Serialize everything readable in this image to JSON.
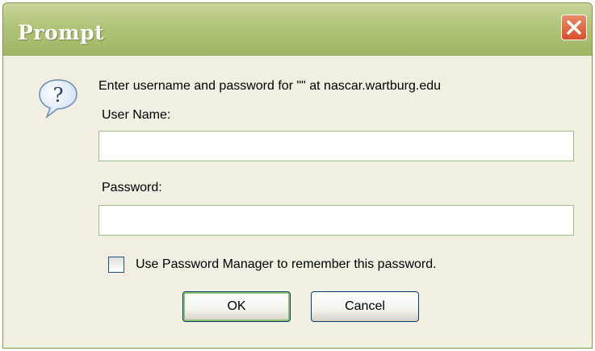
{
  "window": {
    "title": "Prompt",
    "close_glyph": "×"
  },
  "dialog": {
    "icon": "question-icon",
    "message": "Enter username and password for \"\" at nascar.wartburg.edu",
    "username_label": "User Name:",
    "username_value": "",
    "password_label": "Password:",
    "password_value": "",
    "remember_label": "Use Password Manager to remember this password.",
    "remember_checked": false
  },
  "buttons": {
    "ok_label": "OK",
    "cancel_label": "Cancel"
  },
  "colors": {
    "titlebar": "#b2c57c",
    "close_button": "#d5502a",
    "dialog_background": "#f1efe2",
    "field_border": "#9fbd8a",
    "default_button_highlight": "#8fc26e"
  }
}
